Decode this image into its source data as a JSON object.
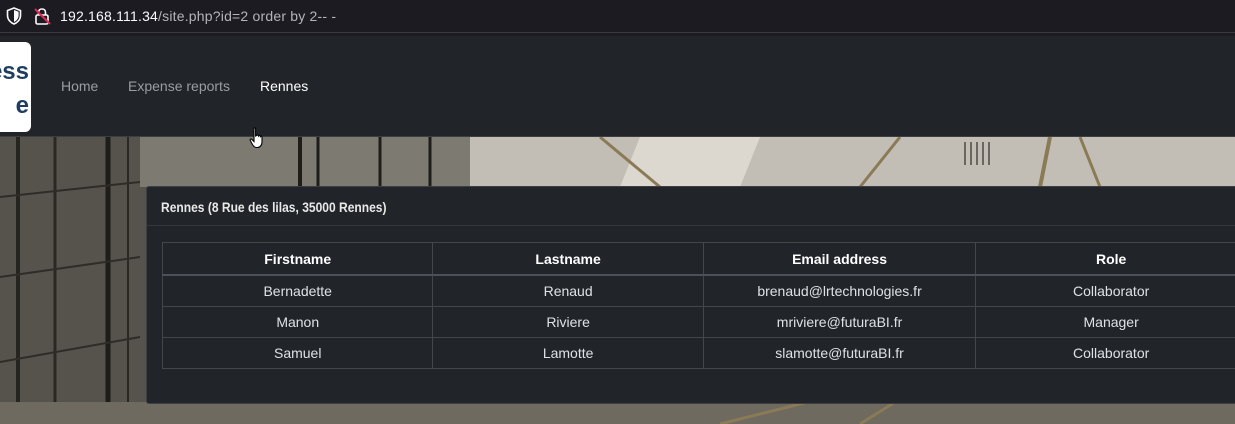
{
  "browser": {
    "url_host": "192.168.111.34",
    "url_path": "/site.php?id=2 order by 2-- -"
  },
  "site": {
    "logo_line1": "ess",
    "logo_line2": "e",
    "nav": [
      {
        "label": "Home",
        "active": false
      },
      {
        "label": "Expense reports",
        "active": false
      },
      {
        "label": "Rennes",
        "active": true
      }
    ]
  },
  "card": {
    "title": "Rennes (8 Rue des lilas, 35000 Rennes)",
    "columns": [
      "Firstname",
      "Lastname",
      "Email address",
      "Role"
    ],
    "rows": [
      [
        "Bernadette",
        "Renaud",
        "brenaud@lrtechnologies.fr",
        "Collaborator"
      ],
      [
        "Manon",
        "Riviere",
        "mriviere@futuraBI.fr",
        "Manager"
      ],
      [
        "Samuel",
        "Lamotte",
        "slamotte@futuraBI.fr",
        "Collaborator"
      ]
    ]
  }
}
